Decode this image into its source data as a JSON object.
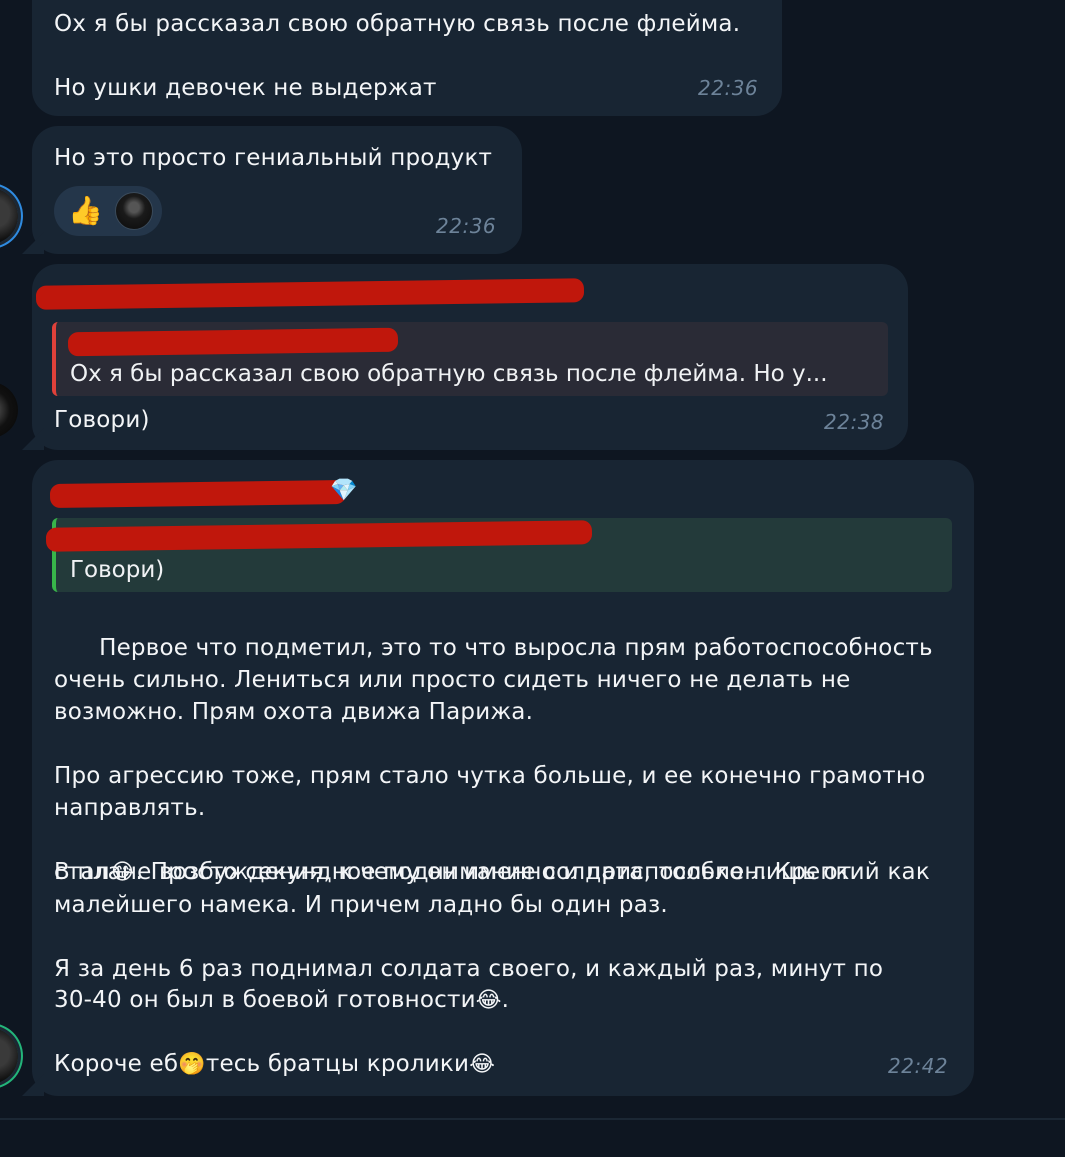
{
  "messages": [
    {
      "lines": "Ох я бы рассказал свою обратную связь после флейма.\n\nНо ушки девочек не выдержат",
      "time": "22:36"
    },
    {
      "lines": "Но это просто гениальный продукт",
      "time": "22:36",
      "reactions": [
        {
          "emoji": "👍",
          "icon": "thumbs-up-icon"
        },
        {
          "icon": "reactor-avatar"
        }
      ]
    },
    {
      "quote": "Ох я бы рассказал свою обратную связь после флейма.   Но у...",
      "lines": "Говори)",
      "time": "22:38"
    },
    {
      "quote": "Говори)",
      "sender_emoji": "💎",
      "body_1": "Первое что подметил, это то что выросла прям работоспособность\nочень сильно. Лениться или просто сидеть ничего не делать не\nвозможно. Прям охота движа Парижа.\n\nПро агрессию тоже, прям стало чутка больше, и ее конечно грамотно\nнаправлять.\n\nВ плане возбуждения, к чему он именно и приспособлен. Крепкий как",
      "body_2a": "стал",
      "emoji_laugh": "😂",
      "body_2b": ". Просто секундное поднимание солдата, только лишь от\nмалейшего намека. И причем ладно бы один раз.\n\nЯ за день 6 раз поднимал солдата своего, и каждый раз, минут по",
      "body_3a": "30-40 он был в боевой готовности",
      "body_3b": ".",
      "body_4a": "Короче еб",
      "emoji_shush": "🤭",
      "body_4b": "тесь братцы кролики",
      "time": "22:42"
    }
  ],
  "colors": {
    "background": "#0e1621",
    "bubble": "#182533",
    "time": "#6d8399",
    "quote_red": "#e0413a",
    "quote_green": "#38b54a",
    "redaction": "#c0170c"
  }
}
